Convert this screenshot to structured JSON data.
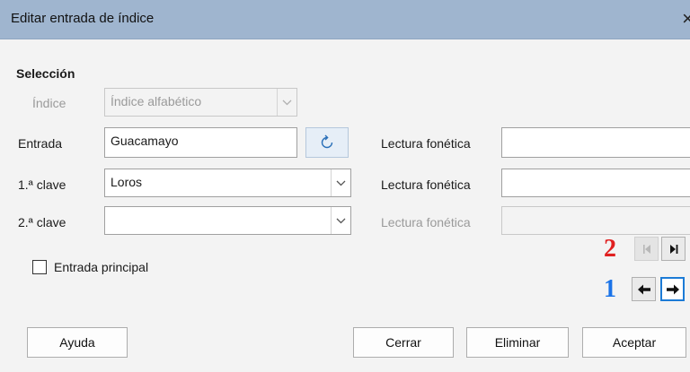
{
  "window": {
    "title": "Editar entrada de índice",
    "close_glyph": "×"
  },
  "section": {
    "title": "Selección"
  },
  "index": {
    "label": "Índice",
    "value": "Índice alfabético",
    "enabled": false
  },
  "entry": {
    "label": "Entrada",
    "value": "Guacamayo",
    "refresh_icon": "refresh-icon"
  },
  "key1": {
    "label": "1.ª clave",
    "value": "Loros"
  },
  "key2": {
    "label": "2.ª clave",
    "value": ""
  },
  "phonetic": {
    "entry_label": "Lectura fonética",
    "key1_label": "Lectura fonética",
    "key2_label": "Lectura fonética",
    "entry_value": "",
    "key1_value": "",
    "key2_value": ""
  },
  "main_entry": {
    "label": "Entrada principal",
    "checked": false
  },
  "markers": {
    "first": "2",
    "second": "1",
    "first_color": "#e02020",
    "second_color": "#1a73e8"
  },
  "navigation": {
    "first_entry_icon": "skip-first-icon",
    "last_entry_icon": "skip-last-icon",
    "previous_icon": "arrow-left-icon",
    "next_icon": "arrow-right-icon"
  },
  "buttons": {
    "help": "Ayuda",
    "close": "Cerrar",
    "delete": "Eliminar",
    "ok": "Aceptar"
  },
  "colors": {
    "titlebar": "#9fb5cf",
    "focus": "#1c7bd6"
  }
}
